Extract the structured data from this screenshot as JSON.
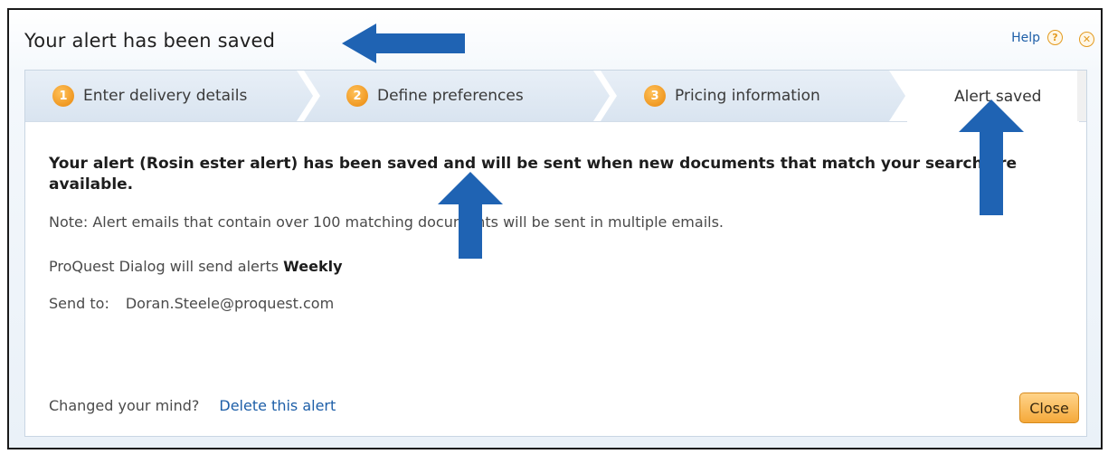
{
  "dialog": {
    "title": "Your alert has been saved",
    "help_label": "Help",
    "help_icon": "question-circle-icon",
    "close_icon": "close-circle-icon"
  },
  "steps": [
    {
      "number": "1",
      "label": "Enter delivery details"
    },
    {
      "number": "2",
      "label": "Define preferences"
    },
    {
      "number": "3",
      "label": "Pricing information"
    },
    {
      "label": "Alert saved"
    }
  ],
  "content": {
    "message": "Your alert (Rosin ester alert) has been saved and will be sent when new documents that match your search are available.",
    "note": "Note: Alert emails that contain over 100 matching documents will be sent in multiple emails.",
    "frequency_prefix": "ProQuest Dialog will send alerts",
    "frequency_value": "Weekly",
    "send_to_label": "Send to:",
    "send_to_email": "Doran.Steele@proquest.com"
  },
  "footer": {
    "prompt": "Changed your mind?",
    "delete_link": "Delete this alert",
    "close_button": "Close"
  },
  "colors": {
    "step_badge": "#e9870b",
    "link": "#1e5fa8",
    "close_button": "#f5a93a",
    "annotation_arrow": "#1f63b3"
  }
}
